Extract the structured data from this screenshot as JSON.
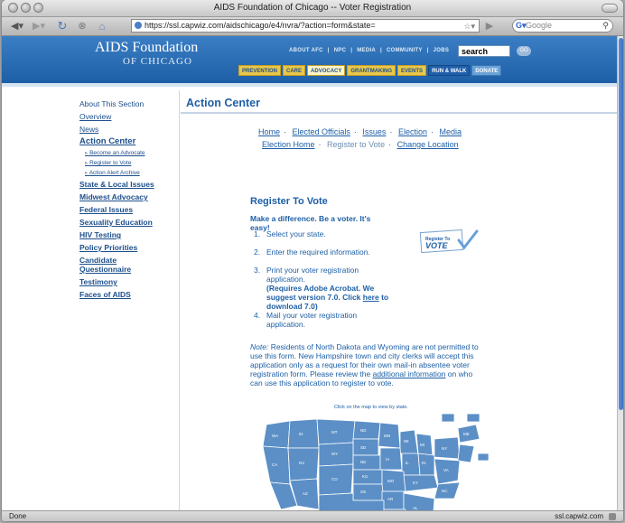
{
  "window": {
    "title": "AIDS Foundation of Chicago -- Voter Registration",
    "url": "https://ssl.capwiz.com/aidschicago/e4/nvra/?action=form&state=",
    "search_engine": "Google",
    "status_left": "Done",
    "status_right": "ssl.capwiz.com"
  },
  "site": {
    "logo_line1": "AIDS Foundation",
    "logo_line2": "OF CHICAGO",
    "utility_links": [
      "ABOUT AFC",
      "|",
      "NPC",
      "|",
      "MEDIA",
      "|",
      "COMMUNITY",
      "|",
      "JOBS"
    ],
    "search_value": "search",
    "go_label": "GO",
    "tabs": [
      "PREVENTION",
      "CARE",
      "ADVOCACY",
      "GRANTMAKING",
      "EVENTS",
      "RUN & WALK",
      "DONATE"
    ]
  },
  "nav": {
    "about": "About This Section",
    "overview": "Overview",
    "news": "News",
    "action_center": "Action Center",
    "sub": [
      "Become an Advocate",
      "Register to Vote",
      "Action Alert Archive"
    ],
    "items": [
      "State & Local Issues",
      "Midwest Advocacy",
      "Federal Issues",
      "Sexuality Education",
      "HIV Testing",
      "Policy Priorities",
      "Candidate Questionnaire",
      "Testimony",
      "Faces of AIDS"
    ]
  },
  "main": {
    "title": "Action Center",
    "crumbs_row1": [
      "Home",
      "Elected Officials",
      "Issues",
      "Election",
      "Media"
    ],
    "crumbs_row2": [
      "Election Home",
      "Register to Vote",
      "Change Location"
    ],
    "heading": "Register To Vote",
    "tagline": "Make a difference. Be a voter. It's easy!",
    "steps": [
      {
        "num": "1.",
        "text": "Select your state."
      },
      {
        "num": "2.",
        "text": "Enter the required information."
      },
      {
        "num": "3.",
        "text": "Print your voter registration application.",
        "note_a": "(Requires Adobe Acrobat. We suggest version 7.0. Click ",
        "note_link": "here",
        "note_b": " to download 7.0)"
      },
      {
        "num": "4.",
        "text": "Mail your voter registration application."
      }
    ],
    "badge_line1": "Register To",
    "badge_line2": "VOTE",
    "note_label": "Note:",
    "note_text_a": " Residents of North Dakota and Wyoming are not permitted to use this form. New Hampshire town and city clerks will accept this application only as a request for their own mail-in absentee voter registration form. Please review the ",
    "note_link": "additional information",
    "note_text_b": " on who can use this application to register to vote.",
    "map_caption": "Click on the map to view by state.",
    "map_color": "#5b8fc6",
    "accent": "#1d5fa6"
  }
}
